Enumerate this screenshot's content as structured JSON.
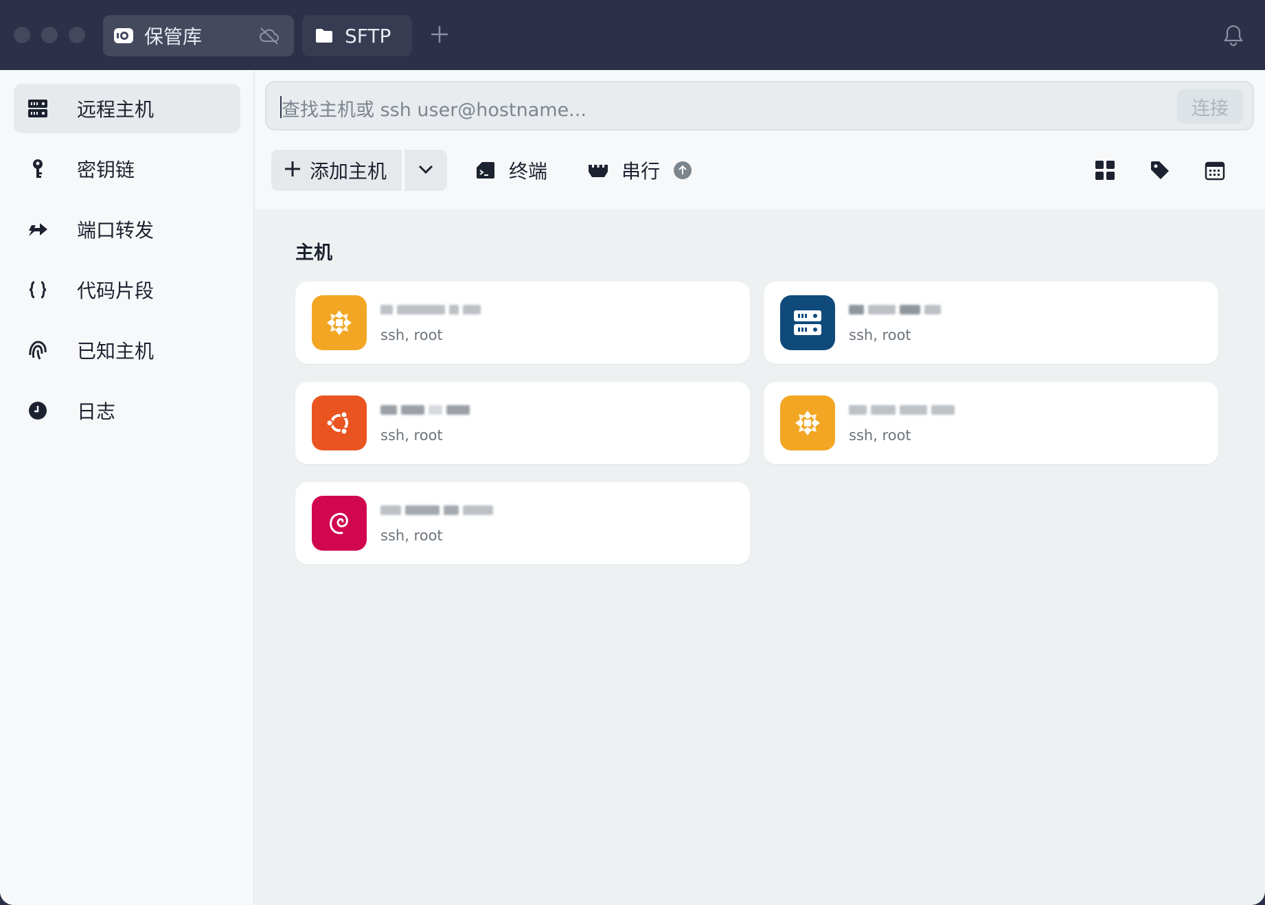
{
  "titlebar": {
    "tabs": [
      {
        "label": "保管库",
        "icon": "vault-icon"
      },
      {
        "label": "SFTP",
        "icon": "folder-icon"
      }
    ],
    "add_tab_icon": "plus-icon",
    "sync_icon": "cloud-off-icon",
    "notification_icon": "bell-icon"
  },
  "sidebar": {
    "items": [
      {
        "label": "远程主机",
        "icon": "server-icon",
        "active": true
      },
      {
        "label": "密钥链",
        "icon": "key-icon",
        "active": false
      },
      {
        "label": "端口转发",
        "icon": "port-forward-icon",
        "active": false
      },
      {
        "label": "代码片段",
        "icon": "braces-icon",
        "active": false
      },
      {
        "label": "已知主机",
        "icon": "fingerprint-icon",
        "active": false
      },
      {
        "label": "日志",
        "icon": "clock-icon",
        "active": false
      }
    ]
  },
  "search": {
    "placeholder": "查找主机或 ssh user@hostname...",
    "connect_label": "连接"
  },
  "toolbar": {
    "add_host_label": "添加主机",
    "terminal_label": "终端",
    "serial_label": "串行",
    "view_icons": [
      "grid-view-icon",
      "tag-icon",
      "calendar-icon"
    ]
  },
  "content": {
    "section_title": "主机",
    "hosts": [
      {
        "subtitle": "ssh, root",
        "os": "centos",
        "color": "#f2a623"
      },
      {
        "subtitle": "ssh, root",
        "os": "generic-server",
        "color": "#0f4a7a"
      },
      {
        "subtitle": "ssh, root",
        "os": "ubuntu",
        "color": "#e95420"
      },
      {
        "subtitle": "ssh, root",
        "os": "centos",
        "color": "#f2a623"
      },
      {
        "subtitle": "ssh, root",
        "os": "debian",
        "color": "#d0074e"
      }
    ]
  },
  "colors": {
    "titlebar": "#2c3149",
    "sidebar": "#f7f8f9",
    "content_bg": "#edf1f2",
    "card": "#ffffff"
  }
}
